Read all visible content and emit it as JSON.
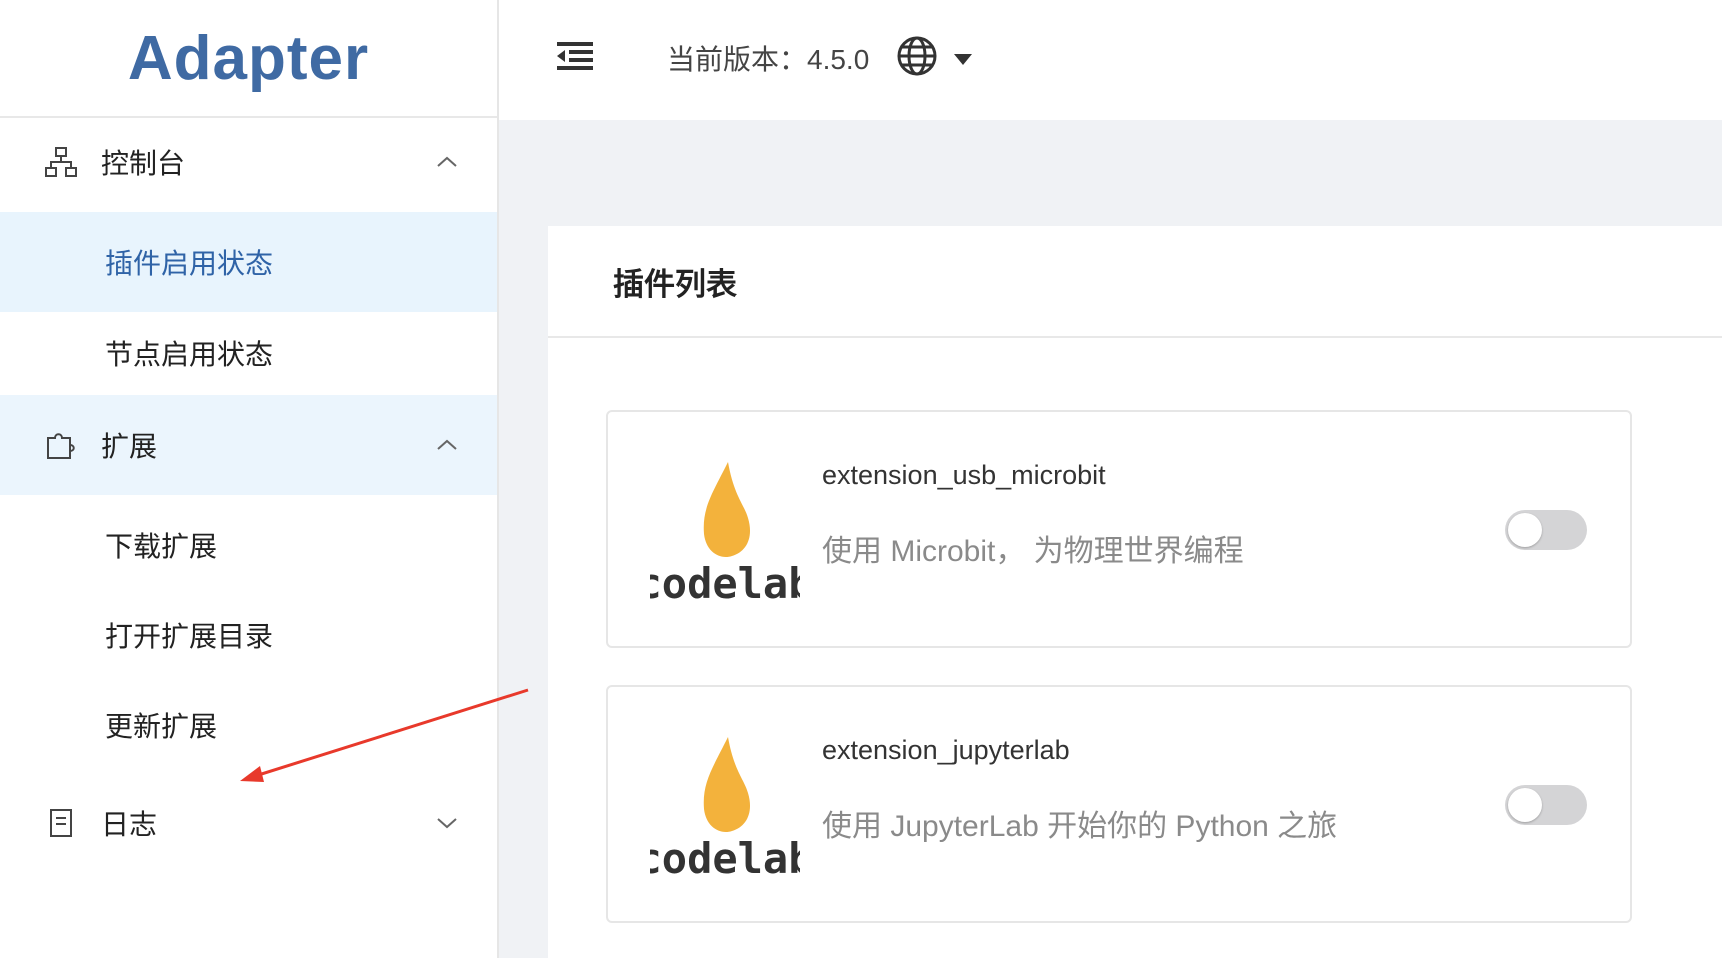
{
  "app": {
    "logo_text": "Adapter"
  },
  "header": {
    "version_text": "当前版本：4.5.0",
    "language_icon": "globe-icon"
  },
  "sidebar": {
    "groups": [
      {
        "label": "控制台",
        "icon": "sitemap-icon",
        "expanded": true,
        "items": [
          {
            "label": "插件启用状态",
            "selected": true
          },
          {
            "label": "节点启用状态",
            "selected": false
          }
        ]
      },
      {
        "label": "扩展",
        "icon": "puzzle-icon",
        "expanded": true,
        "items": [
          {
            "label": "下载扩展",
            "selected": false
          },
          {
            "label": "打开扩展目录",
            "selected": false
          },
          {
            "label": "更新扩展",
            "selected": false
          }
        ]
      },
      {
        "label": "日志",
        "icon": "document-icon",
        "expanded": false,
        "items": []
      }
    ]
  },
  "main": {
    "panel_title": "插件列表",
    "plugins": [
      {
        "name": "extension_usb_microbit",
        "description": "使用 Microbit， 为物理世界编程",
        "logo_text": "codelab",
        "enabled": false
      },
      {
        "name": "extension_jupyterlab",
        "description": "使用 JupyterLab 开始你的 Python 之旅",
        "logo_text": "codelab",
        "enabled": false
      }
    ]
  },
  "colors": {
    "brand": "#3f6aa3",
    "selected_text": "#2f63a7",
    "selected_bg": "#e8f4fd",
    "annotation_arrow": "#e8392b",
    "flame": "#f3b23c"
  }
}
